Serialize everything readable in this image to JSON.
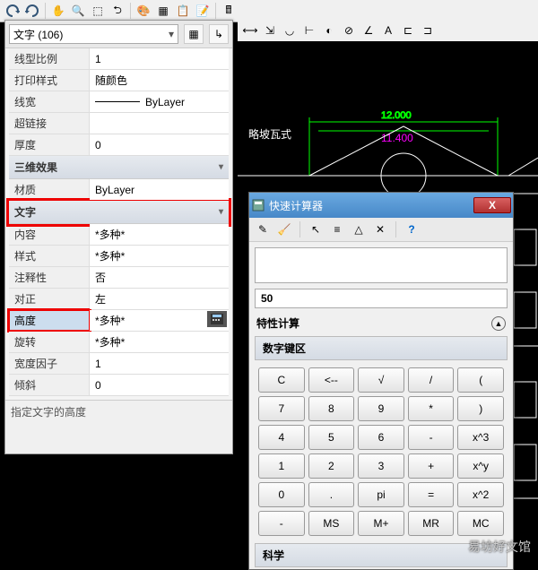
{
  "object_type": "文字 (106)",
  "sections": {
    "general": [
      {
        "label": "线型比例",
        "value": "1"
      },
      {
        "label": "打印样式",
        "value": "随颜色"
      },
      {
        "label": "线宽",
        "value": "ByLayer",
        "lineweight": true
      },
      {
        "label": "超链接",
        "value": ""
      },
      {
        "label": "厚度",
        "value": "0"
      }
    ],
    "s3d_title": "三维效果",
    "s3d": [
      {
        "label": "材质",
        "value": "ByLayer"
      }
    ],
    "text_title": "文字",
    "text": [
      {
        "label": "内容",
        "value": "*多种*"
      },
      {
        "label": "样式",
        "value": "*多种*"
      },
      {
        "label": "注释性",
        "value": "否"
      },
      {
        "label": "对正",
        "value": "左"
      },
      {
        "label": "高度",
        "value": "*多种*",
        "hl": true,
        "calc": true
      },
      {
        "label": "旋转",
        "value": "*多种*"
      },
      {
        "label": "宽度因子",
        "value": "1"
      },
      {
        "label": "倾斜",
        "value": "0"
      }
    ]
  },
  "hint": "指定文字的高度",
  "calc": {
    "title": "快速计算器",
    "result": "50",
    "subtitle": "特性计算",
    "numpad_title": "数字键区",
    "keys": [
      "C",
      "<--",
      "√",
      "/",
      "(",
      "7",
      "8",
      "9",
      "*",
      ")",
      "4",
      "5",
      "6",
      "-",
      "x^3",
      "1",
      "2",
      "3",
      "+",
      "x^y",
      "0",
      ".",
      "pi",
      "=",
      "x^2",
      "-",
      "MS",
      "M+",
      "MR",
      "MC"
    ],
    "sci_title": "科学"
  },
  "drawing": {
    "dim1": "12.000",
    "dim2": "11.400",
    "note": "略坡瓦式"
  },
  "watermark": "易坊好文馆"
}
